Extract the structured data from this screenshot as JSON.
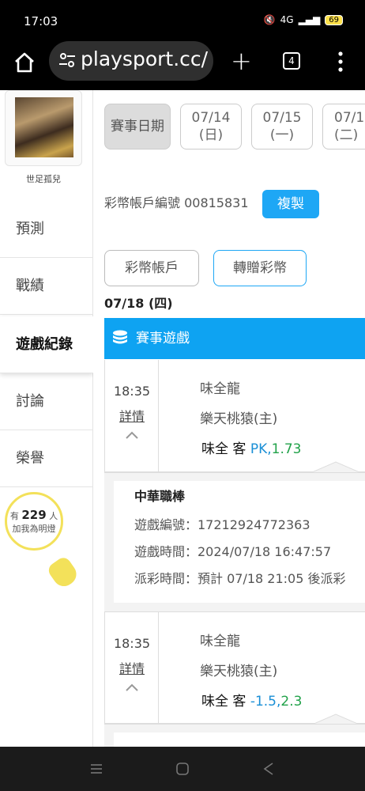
{
  "status": {
    "time": "17:03",
    "network": "4G",
    "battery": "69"
  },
  "browser": {
    "url": "playsport.cc/",
    "tab_count": "4"
  },
  "sidebar": {
    "username": "世足孤兒",
    "items": [
      {
        "label": "預測"
      },
      {
        "label": "戰績"
      },
      {
        "label": "遊戲紀錄"
      },
      {
        "label": "討論"
      },
      {
        "label": "榮譽"
      }
    ],
    "lamp": {
      "prefix": "有",
      "count": "229",
      "suffix": "人",
      "caption": "加我為明燈"
    }
  },
  "main": {
    "date_label": "賽事日期",
    "dates": [
      {
        "date": "07/14",
        "weekday": "(日)"
      },
      {
        "date": "07/15",
        "weekday": "(一)"
      },
      {
        "date": "07/1",
        "weekday": "(二)"
      }
    ],
    "account_text": "彩幣帳戶編號 00815831",
    "copy_label": "複製",
    "tabs": [
      {
        "label": "彩幣帳戶"
      },
      {
        "label": "轉贈彩幣"
      }
    ],
    "date_heading": "07/18 (四)",
    "section_title": "賽事遊戲",
    "games": [
      {
        "time": "18:35",
        "detail": "詳情",
        "away": "味全龍",
        "home": "樂天桃猿(主)",
        "pick_team": "味全 客",
        "pick_line": "PK,",
        "pick_odds": "1.73"
      },
      {
        "time": "18:35",
        "detail": "詳情",
        "away": "味全龍",
        "home": "樂天桃猿(主)",
        "pick_team": "味全 客",
        "pick_line": "-1.5,",
        "pick_odds": "2.3"
      }
    ],
    "detail": {
      "league": "中華職棒",
      "game_id": "遊戲編號：17212924772363",
      "game_time": "遊戲時間：2024/07/18 16:47:57",
      "payout_time": "派彩時間：預計 07/18 21:05 後派彩"
    }
  }
}
